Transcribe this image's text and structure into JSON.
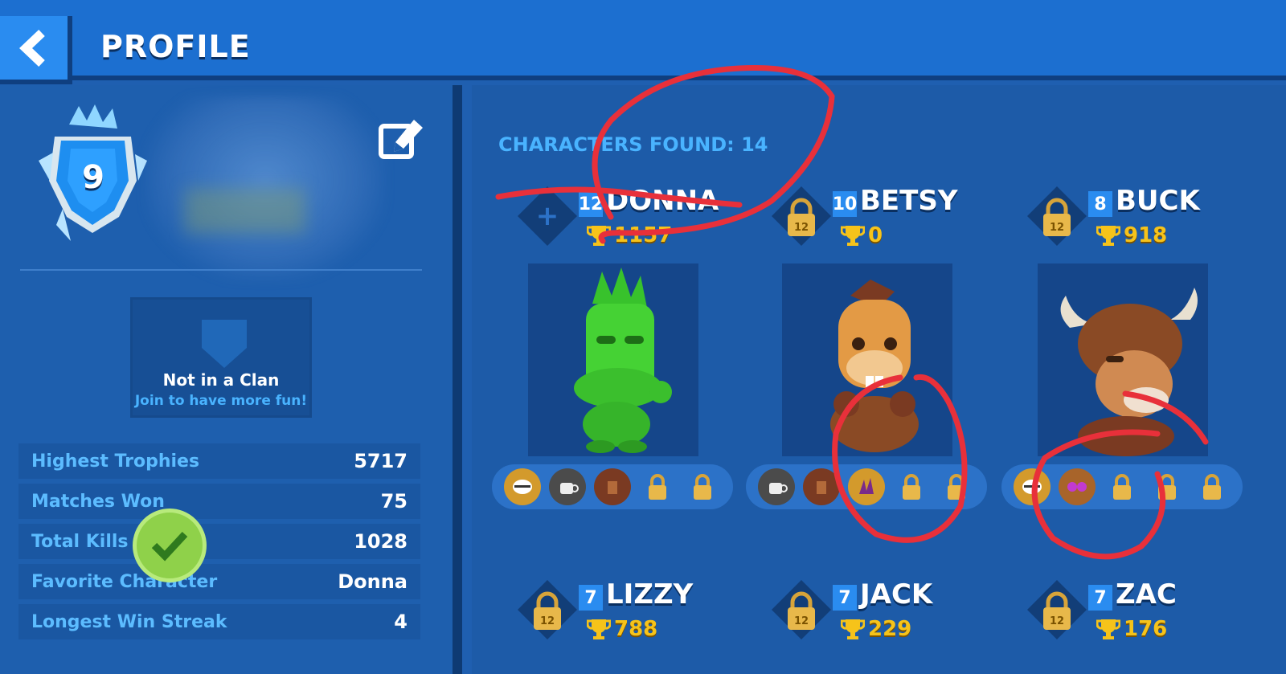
{
  "header": {
    "title": "PROFILE"
  },
  "profile": {
    "level": "9",
    "clan_title": "Not in a Clan",
    "clan_subtitle": "Join to have more fun!"
  },
  "stats": [
    {
      "label": "Highest Trophies",
      "value": "5717"
    },
    {
      "label": "Matches Won",
      "value": "75"
    },
    {
      "label": "Total Kills",
      "value": "1028"
    },
    {
      "label": "Favorite Character",
      "value": "Donna"
    },
    {
      "label": "Longest Win Streak",
      "value": "4"
    }
  ],
  "characters_found_label": "CHARACTERS FOUND: 14",
  "characters": [
    {
      "name": "DONNA",
      "level": "12",
      "trophies": "1157",
      "skills": [
        "jaw-icon",
        "coffee-cup-icon",
        "stump-icon",
        "lock-icon",
        "lock-icon"
      ]
    },
    {
      "name": "BETSY",
      "level": "10",
      "trophies": "0",
      "lock_level": "12",
      "skills": [
        "coffee-cup-icon",
        "stump-icon",
        "claw-icon",
        "lock-icon",
        "lock-icon"
      ]
    },
    {
      "name": "BUCK",
      "level": "8",
      "trophies": "918",
      "lock_level": "12",
      "skills": [
        "jaw-icon",
        "goggles-icon",
        "lock-icon",
        "lock-icon",
        "lock-icon"
      ]
    },
    {
      "name": "LIZZY",
      "level": "7",
      "trophies": "788",
      "lock_level": "12"
    },
    {
      "name": "JACK",
      "level": "7",
      "trophies": "229",
      "lock_level": "12"
    },
    {
      "name": "ZAC",
      "level": "7",
      "trophies": "176",
      "lock_level": "12"
    }
  ],
  "colors": {
    "header": "#1c6fd0",
    "panel": "#1e5fae",
    "accent_text": "#49b3ff",
    "trophy": "#f6c31a",
    "annotation": "#e8303a",
    "check": "#8fd14a"
  }
}
